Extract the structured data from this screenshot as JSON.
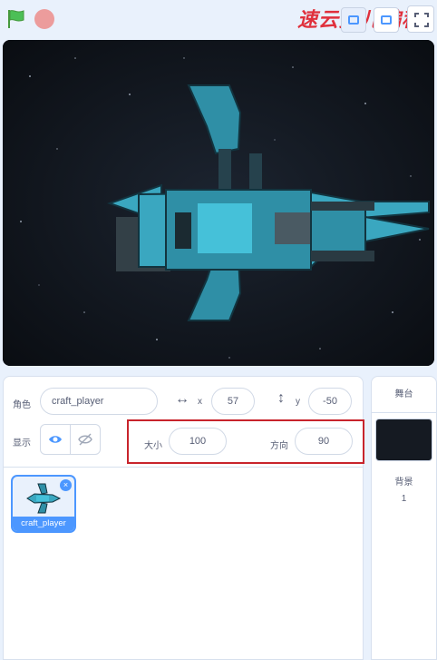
{
  "watermark": "速云少儿编程",
  "icons": {
    "green_flag": "green-flag-icon",
    "stop": "stop-icon",
    "fullscreen": "fullscreen-icon",
    "show": "eye-icon",
    "hide": "eye-slash-icon"
  },
  "colors": {
    "accent": "#4c97ff",
    "highlight_box": "#c8242c",
    "flag": "#4cbf56",
    "stop": "#ec9c9c"
  },
  "sprite_info": {
    "sprite_label": "角色",
    "sprite_name": "craft_player",
    "x_label": "x",
    "x_value": "57",
    "y_label": "y",
    "y_value": "-50",
    "show_label": "显示",
    "size_label": "大小",
    "size_value": "100",
    "direction_label": "方向",
    "direction_value": "90"
  },
  "sprites": [
    {
      "name": "craft_player",
      "delete_symbol": "×"
    }
  ],
  "stage_panel": {
    "title": "舞台",
    "backdrop_label": "背景",
    "backdrop_count": "1"
  }
}
